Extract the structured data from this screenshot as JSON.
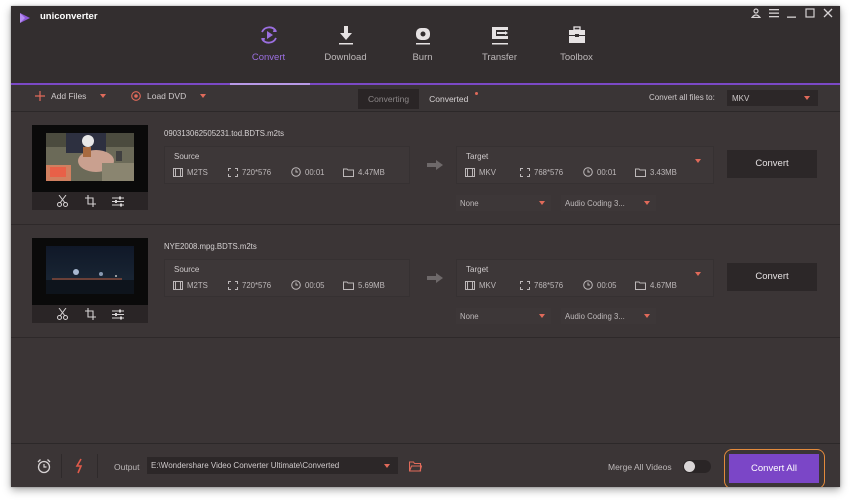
{
  "app": {
    "name": "uniconverter",
    "window_controls": [
      "account",
      "menu",
      "minimize",
      "maximize",
      "close"
    ]
  },
  "nav": {
    "tabs": [
      {
        "label": "Convert",
        "icon": "convert-icon",
        "active": true
      },
      {
        "label": "Download",
        "icon": "download-icon",
        "active": false
      },
      {
        "label": "Burn",
        "icon": "burn-disc-icon",
        "active": false
      },
      {
        "label": "Transfer",
        "icon": "transfer-icon",
        "active": false
      },
      {
        "label": "Toolbox",
        "icon": "toolbox-icon",
        "active": false
      }
    ]
  },
  "toolbar": {
    "add_files": "Add Files",
    "load_dvd": "Load DVD",
    "segment": {
      "converting": "Converting",
      "converted": "Converted"
    },
    "convert_all_label": "Convert all files to:",
    "convert_all_format": "MKV"
  },
  "files": [
    {
      "name": "090313062505231.tod.BDTS.m2ts",
      "source": {
        "title": "Source",
        "format": "M2TS",
        "resolution": "720*576",
        "duration": "00:01",
        "size": "4.47MB"
      },
      "target": {
        "title": "Target",
        "format": "MKV",
        "resolution": "768*576",
        "duration": "00:01",
        "size": "3.43MB"
      },
      "subtitle": "None",
      "audio": "Audio Coding 3...",
      "convert_label": "Convert"
    },
    {
      "name": "NYE2008.mpg.BDTS.m2ts",
      "source": {
        "title": "Source",
        "format": "M2TS",
        "resolution": "720*576",
        "duration": "00:05",
        "size": "5.69MB"
      },
      "target": {
        "title": "Target",
        "format": "MKV",
        "resolution": "768*576",
        "duration": "00:05",
        "size": "4.67MB"
      },
      "subtitle": "None",
      "audio": "Audio Coding 3...",
      "convert_label": "Convert"
    }
  ],
  "footer": {
    "output_label": "Output",
    "output_path": "E:\\Wondershare Video Converter Ultimate\\Converted",
    "merge_label": "Merge All Videos",
    "merge_enabled": false,
    "convert_all_button": "Convert All"
  },
  "colors": {
    "accent_purple": "#7b46c7",
    "active_tab": "#9b6fe0",
    "dropdown_arrow": "#e06a5a",
    "highlight_ring": "#e38a3c",
    "window_bg": "#3b3536"
  }
}
